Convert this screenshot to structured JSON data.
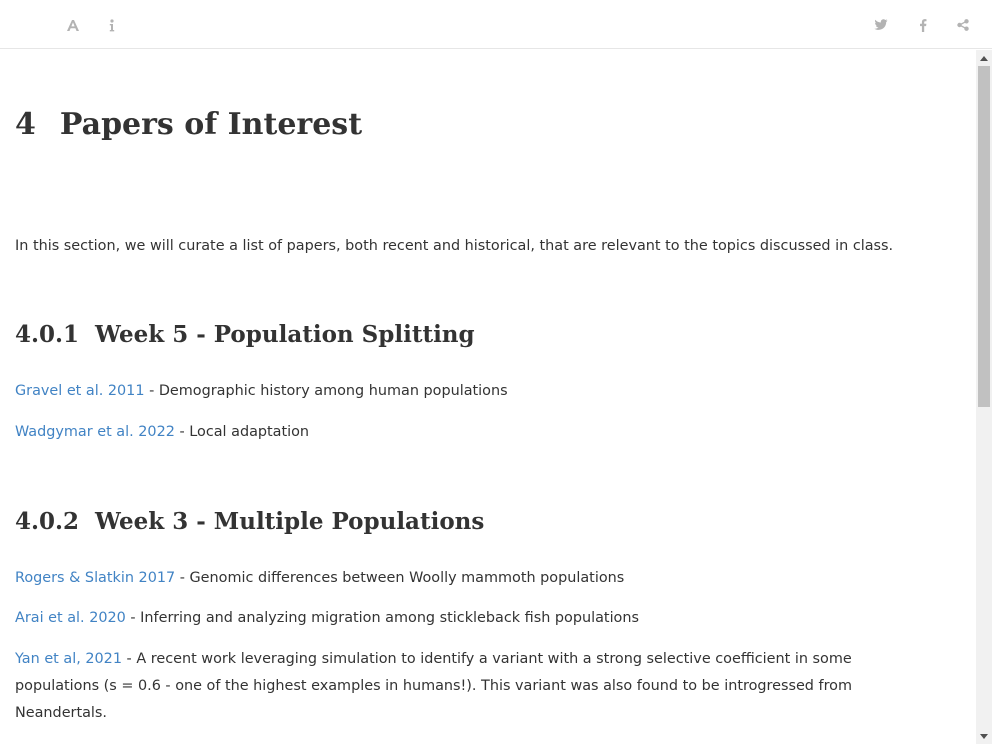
{
  "toolbar": {
    "left": [
      {
        "name": "font-settings-button",
        "icon": "font-icon"
      },
      {
        "name": "info-button",
        "icon": "info-icon"
      }
    ],
    "right": [
      {
        "name": "twitter-share-button",
        "icon": "twitter-icon"
      },
      {
        "name": "facebook-share-button",
        "icon": "facebook-icon"
      },
      {
        "name": "share-button",
        "icon": "share-icon"
      }
    ],
    "icon_color": "#b3b3b3"
  },
  "chapter": {
    "number": "4",
    "title": "Papers of Interest",
    "intro": "In this section, we will curate a list of papers, both recent and historical, that are relevant to the topics discussed in class."
  },
  "sections": [
    {
      "number": "4.0.1",
      "title": "Week 5 - Population Splitting",
      "papers": [
        {
          "link": "Gravel et al. 2011",
          "description": " - Demographic history among human populations"
        },
        {
          "link": "Wadgymar et al. 2022",
          "description": " - Local adaptation"
        }
      ]
    },
    {
      "number": "4.0.2",
      "title": "Week 3 - Multiple Populations",
      "papers": [
        {
          "link": "Rogers & Slatkin 2017",
          "description": " - Genomic differences between Woolly mammoth populations"
        },
        {
          "link": "Arai et al. 2020",
          "description": " - Inferring and analyzing migration among stickleback fish populations"
        },
        {
          "link": "Yan et al, 2021",
          "description": " - A recent work leveraging simulation to identify a variant with a strong selective coefficient in some populations (s = 0.6 - one of the highest examples in humans!). This variant was also found to be introgressed from Neandertals."
        }
      ]
    }
  ],
  "colors": {
    "link": "#4183c4",
    "text": "#333333",
    "border": "#e6e6e6"
  }
}
